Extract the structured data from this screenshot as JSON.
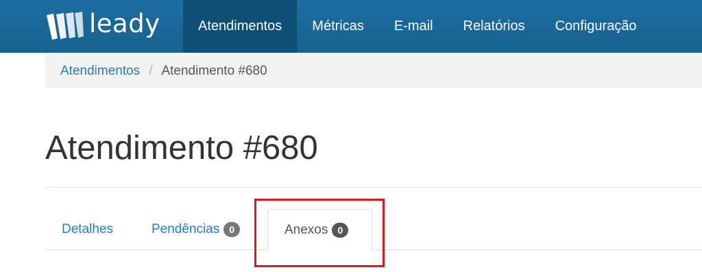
{
  "brand": {
    "name": "leady",
    "logo_icon": "leady-logo-icon"
  },
  "navbar": {
    "items": [
      {
        "label": "Atendimentos",
        "active": true
      },
      {
        "label": "Métricas",
        "active": false
      },
      {
        "label": "E-mail",
        "active": false
      },
      {
        "label": "Relatórios",
        "active": false
      },
      {
        "label": "Configuração",
        "active": false
      }
    ]
  },
  "breadcrumb": {
    "parent": "Atendimentos",
    "separator": "/",
    "current": "Atendimento #680"
  },
  "page": {
    "title": "Atendimento #680"
  },
  "tabs": [
    {
      "label": "Detalhes",
      "active": false
    },
    {
      "label": "Pendências",
      "count": "0",
      "active": false
    },
    {
      "label": "Anexos",
      "count": "0",
      "active": true
    }
  ],
  "colors": {
    "navbar": "#1a6496",
    "nav_active": "#0f4e75",
    "link": "#2a7ab8",
    "annotation": "#e0161b"
  }
}
